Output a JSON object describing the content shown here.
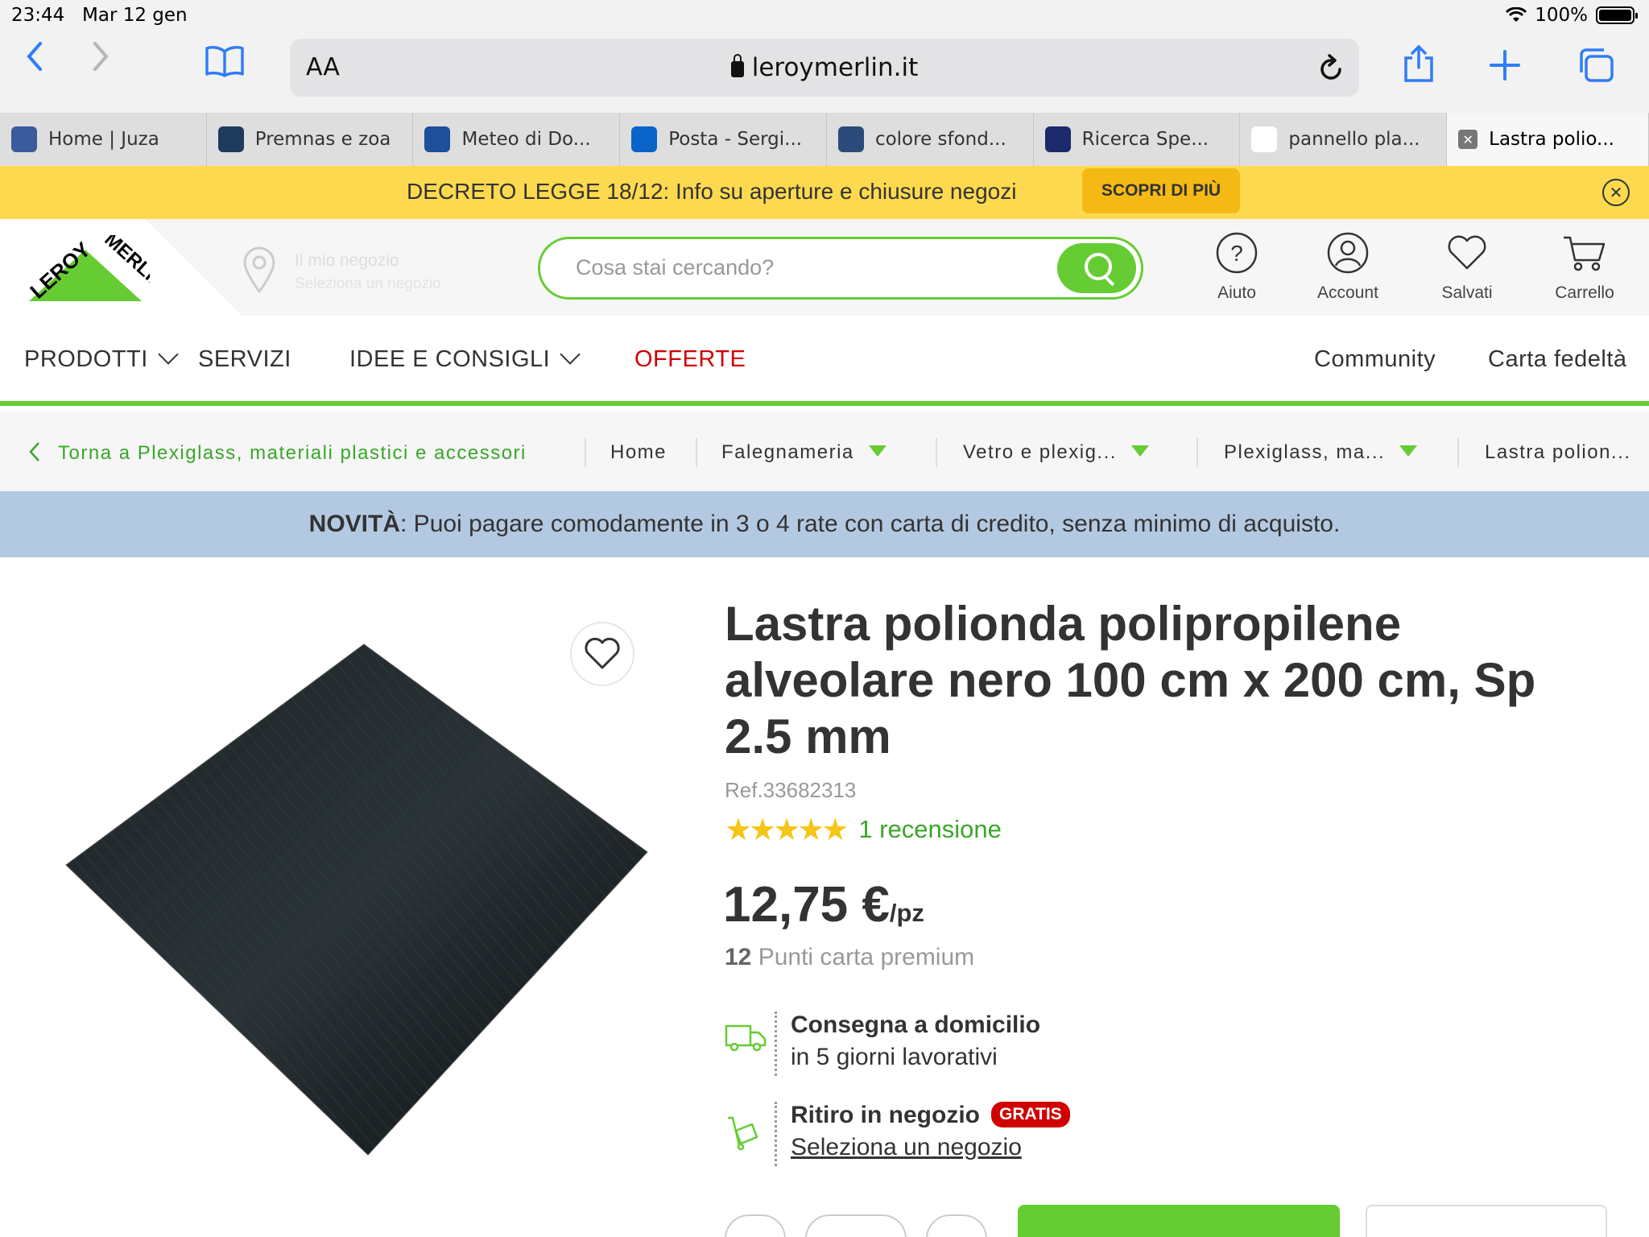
{
  "status_bar": {
    "time": "23:44",
    "date": "Mar 12 gen",
    "battery": "100%",
    "battery_level": 1.0
  },
  "browser": {
    "aa_label": "AA",
    "url": "leroymerlin.it",
    "icons": [
      "back-icon",
      "forward-icon",
      "bookmarks-icon",
      "reload-icon",
      "share-icon",
      "new-tab-icon",
      "tabs-icon"
    ]
  },
  "tabs": [
    {
      "label": "Home | Juza",
      "favicon_color": "#3b5b9a"
    },
    {
      "label": "Premnas e zoa",
      "favicon_color": "#1e3a5c"
    },
    {
      "label": "Meteo di Do...",
      "favicon_color": "#1d4f9a"
    },
    {
      "label": "Posta - Sergi...",
      "favicon_color": "#0a64c8"
    },
    {
      "label": "colore sfond...",
      "favicon_color": "#2a4b7a"
    },
    {
      "label": "Ricerca Spe...",
      "favicon_color": "#1b2a6b"
    },
    {
      "label": "pannello pla...",
      "favicon_color": "#ffffff"
    },
    {
      "label": "Lastra polio...",
      "active": true
    }
  ],
  "banner": {
    "text": "DECRETO LEGGE 18/12: Info su aperture e chiusure negozi",
    "cta": "SCOPRI DI PIÙ",
    "bg_color": "#fdd94f"
  },
  "header": {
    "logo_text_top": "LEROY",
    "logo_text_bottom": "MERLIN",
    "store_line1": "Il mio negozio",
    "store_line2": "Seleziona un negozio",
    "search_placeholder": "Cosa stai cercando?",
    "icons": [
      {
        "label": "Aiuto",
        "icon": "help-icon"
      },
      {
        "label": "Account",
        "icon": "account-icon"
      },
      {
        "label": "Salvati",
        "icon": "heart-icon"
      },
      {
        "label": "Carrello",
        "icon": "cart-icon"
      }
    ],
    "brand_color": "#66cc33"
  },
  "nav": {
    "prodotti": "PRODOTTI",
    "servizi": "SERVIZI",
    "idee": "IDEE E CONSIGLI",
    "offerte": "OFFERTE",
    "community": "Community",
    "carta": "Carta fedeltà"
  },
  "breadcrumb": {
    "back": "Torna a Plexiglass, materiali plastici e accessori",
    "items": [
      "Home",
      "Falegnameria",
      "Vetro e plexig...",
      "Plexiglass, ma...",
      "Lastra polion..."
    ]
  },
  "notice": {
    "bold": "NOVITÀ",
    "text": ": Puoi pagare comodamente in 3 o 4 rate con carta di credito, senza minimo di acquisto."
  },
  "product": {
    "title": "Lastra polionda polipropilene alveolare nero 100 cm x 200 cm, Sp 2.5 mm",
    "ref": "Ref.33682313",
    "rating": 5,
    "stars": "★★★★★",
    "reviews": "1 recensione",
    "price": "12,75 €",
    "unit": "/pz",
    "points_num": "12",
    "points_text": " Punti carta premium",
    "delivery_title": "Consegna a domicilio",
    "delivery_sub": "in 5 giorni lavorativi",
    "pickup_title": "Ritiro in negozio",
    "pickup_badge": "GRATIS",
    "pickup_link": "Seleziona un negozio"
  }
}
